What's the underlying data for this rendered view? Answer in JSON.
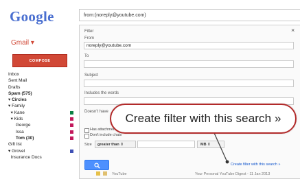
{
  "sidebar": {
    "logo": "Google",
    "gmail_label": "Gmail ▾",
    "compose_label": "COMPOSE",
    "items": [
      {
        "label": "Inbox",
        "bold": false,
        "color": ""
      },
      {
        "label": "Sent Mail",
        "bold": false,
        "color": ""
      },
      {
        "label": "Drafts",
        "bold": false,
        "color": ""
      },
      {
        "label": "Spam (575)",
        "bold": true,
        "color": ""
      },
      {
        "label": "▾ Circles",
        "bold": true,
        "color": ""
      },
      {
        "label": "▾ Family",
        "bold": false,
        "color": ""
      },
      {
        "label": "  ▾ Kane",
        "bold": false,
        "color": "#0b8043"
      },
      {
        "label": "  ▾ Kids",
        "bold": false,
        "color": "#c2185b"
      },
      {
        "label": "      George",
        "bold": false,
        "color": "#c2185b"
      },
      {
        "label": "      Issa",
        "bold": false,
        "color": "#c2185b"
      },
      {
        "label": "      Tom (30)",
        "bold": true,
        "color": "#c2185b"
      },
      {
        "label": "Gift list",
        "bold": false,
        "color": ""
      },
      {
        "label": "▾ Grovel",
        "bold": false,
        "color": "#3f51b5"
      },
      {
        "label": "  Insurance Docs",
        "bold": false,
        "color": ""
      }
    ]
  },
  "search": {
    "query": "from:(noreply@youtube.com)"
  },
  "filter": {
    "title": "Filter",
    "from_label": "From",
    "from_value": "noreply@youtube.com",
    "to_label": "To",
    "to_value": "",
    "subject_label": "Subject",
    "subject_value": "",
    "has_words_label": "Includes the words",
    "has_words_value": "",
    "doesnt_have_label": "Doesn't have",
    "has_attachment_label": "Has attachment",
    "no_chats_label": "Don't include chats",
    "size_label": "Size",
    "size_operator": "greater than ⇕",
    "size_unit": "MB ⇕",
    "create_filter_link": "Create filter with this search »",
    "close_label": "×"
  },
  "callout": {
    "text": "Create filter with this search »",
    "border_color": "#b22a2a"
  },
  "background_row": {
    "sender": "YouTube",
    "subject": "Your Personal YouTube Digest - 11 Jan 2013"
  },
  "colors": {
    "compose_button": "#d14836",
    "search_button": "#4d90fe",
    "link": "#1155cc"
  },
  "icons": {
    "search_button_icon": "search-icon",
    "close_icon": "close-icon"
  }
}
